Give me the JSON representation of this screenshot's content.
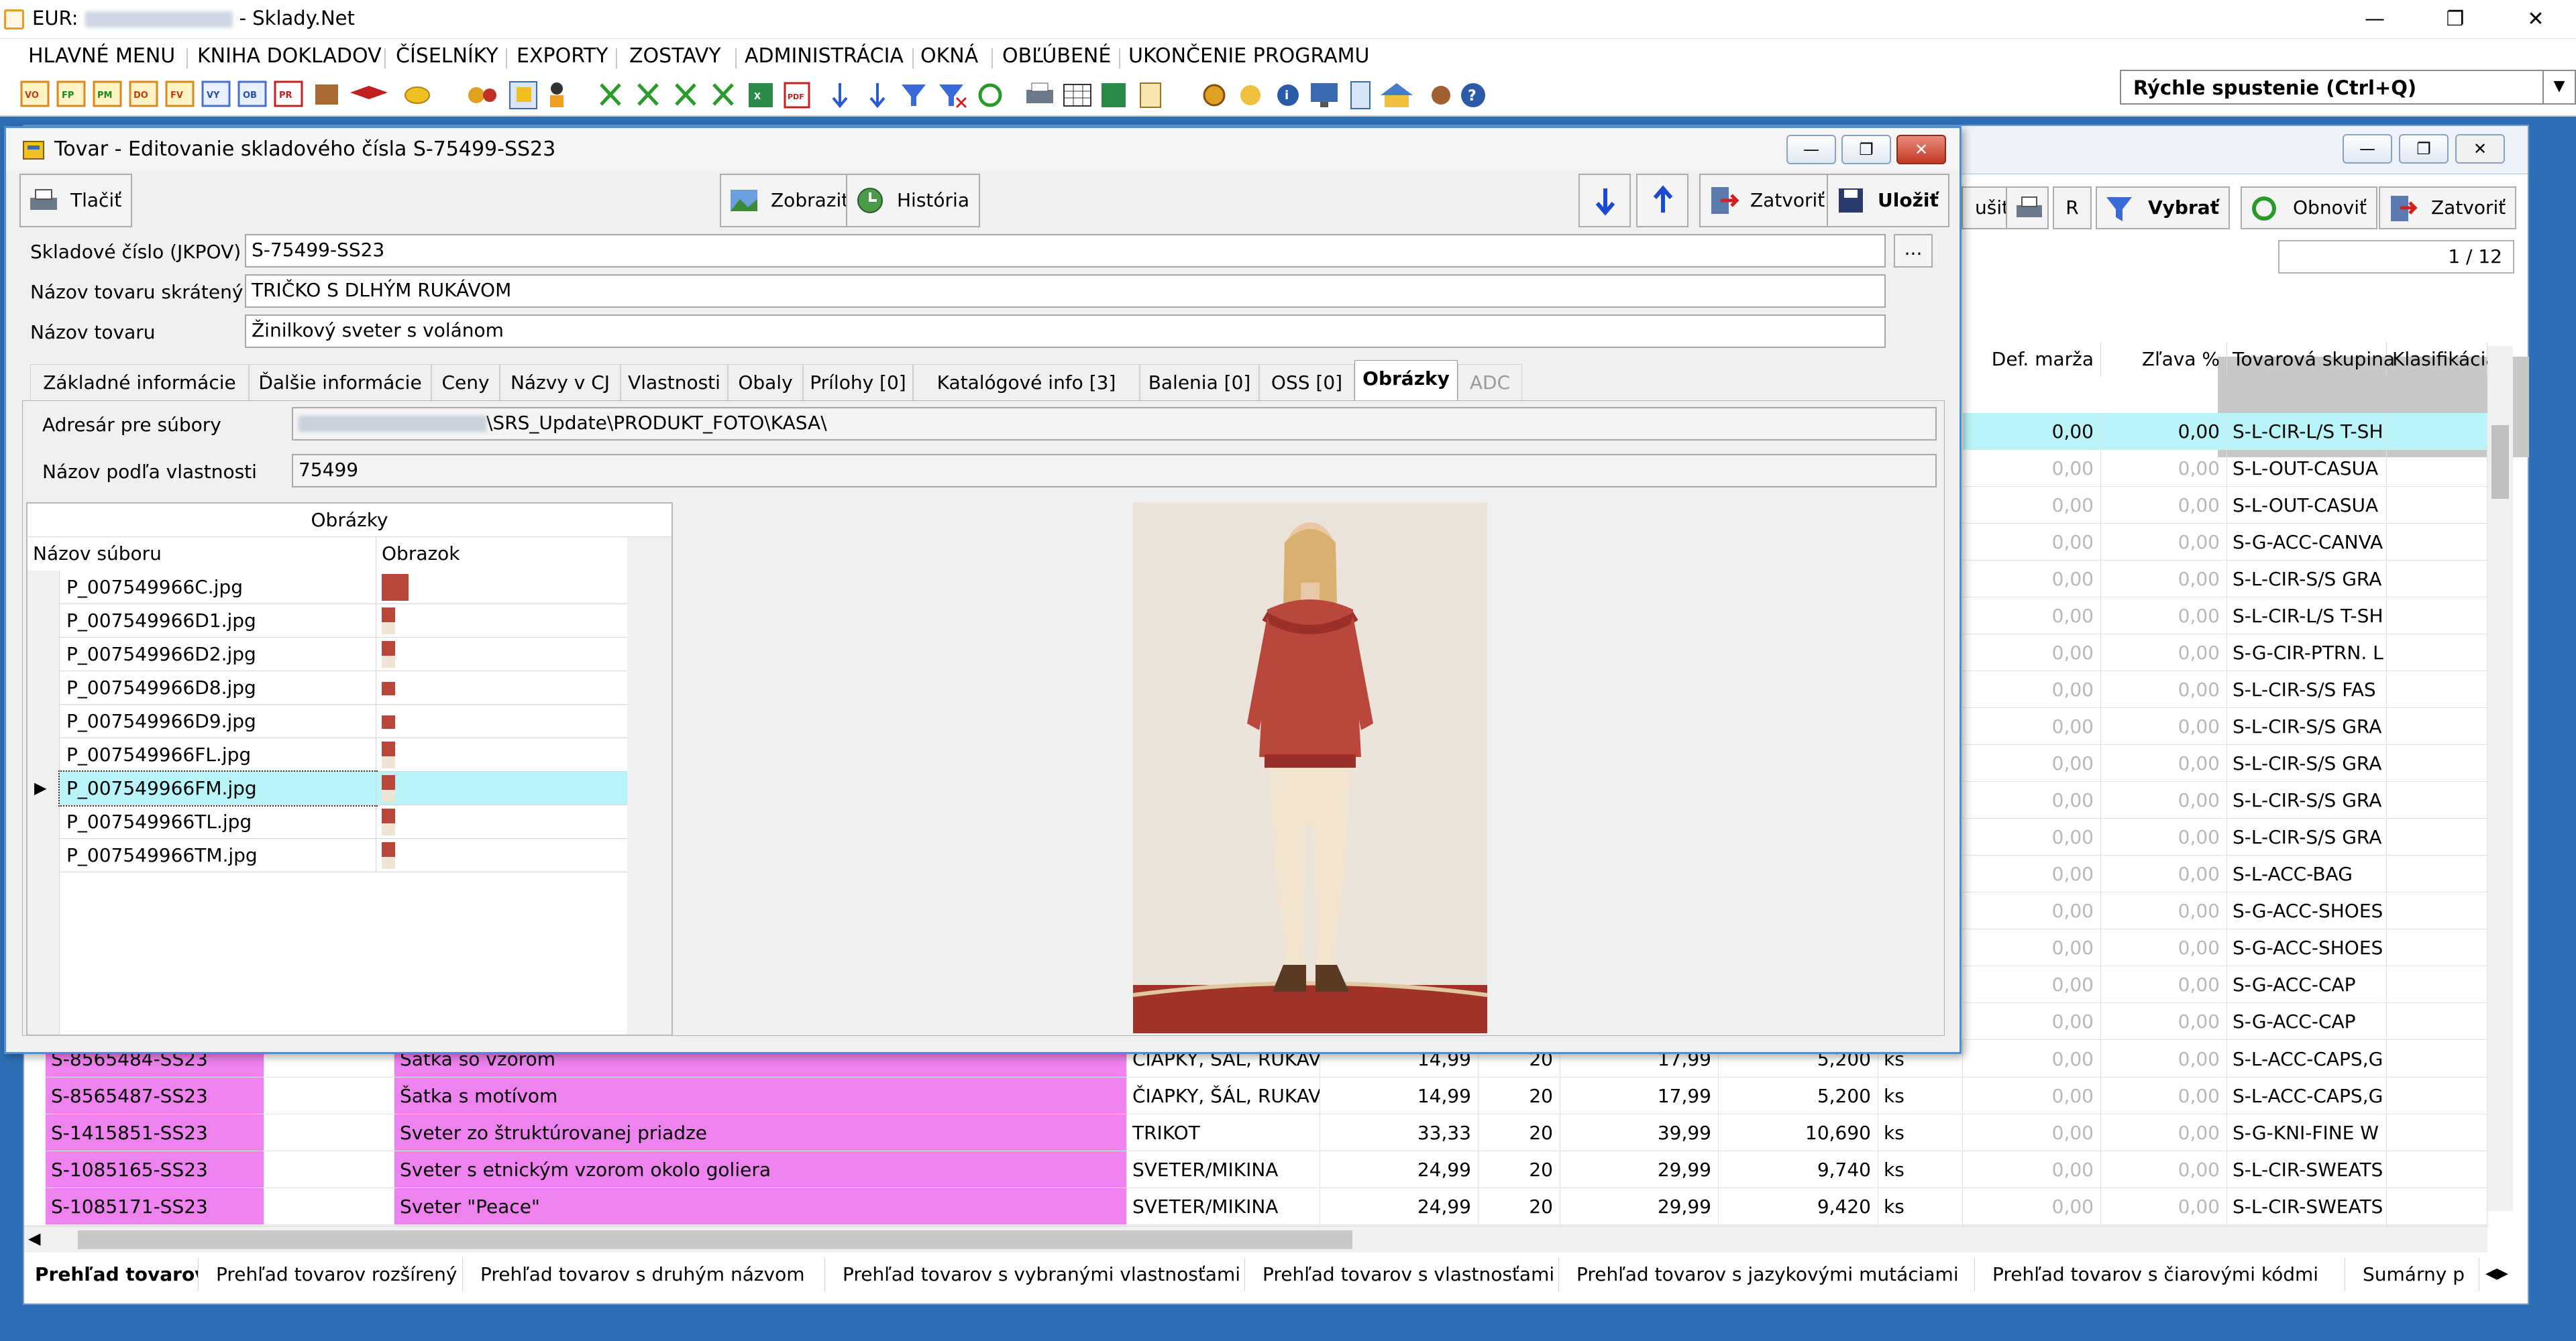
{
  "window": {
    "title_prefix": "EUR:",
    "title_suffix": "- Sklady.Net"
  },
  "menu": [
    "HLAVNÉ MENU",
    "KNIHA DOKLADOV",
    "ČÍSELNÍKY",
    "EXPORTY",
    "ZOSTAVY",
    "ADMINISTRÁCIA",
    "OKNÁ",
    "OBĽÚBENÉ",
    "UKONČENIE PROGRAMU"
  ],
  "quick_launch": {
    "label": "Rýchle spustenie (Ctrl+Q)"
  },
  "background_window": {
    "buttons": {
      "cancel_partial": "ušiť",
      "r": "R",
      "select": "Vybrať",
      "refresh": "Obnoviť",
      "close": "Zatvoriť"
    },
    "pager": "1 / 12",
    "headers": {
      "def_marza": "Def. marža",
      "zlava": "Zľava %",
      "skupina": "Tovarová skupina",
      "klasifikacia": "Klasifikácia"
    },
    "right_rows": [
      {
        "marza": "0,00",
        "zlava": "0,00",
        "skupina": "S-L-CIR-L/S T-SH"
      },
      {
        "marza": "0,00",
        "zlava": "0,00",
        "skupina": "S-L-OUT-CASUA"
      },
      {
        "marza": "0,00",
        "zlava": "0,00",
        "skupina": "S-L-OUT-CASUA"
      },
      {
        "marza": "0,00",
        "zlava": "0,00",
        "skupina": "S-G-ACC-CANVA"
      },
      {
        "marza": "0,00",
        "zlava": "0,00",
        "skupina": "S-L-CIR-S/S GRA"
      },
      {
        "marza": "0,00",
        "zlava": "0,00",
        "skupina": "S-L-CIR-L/S T-SH"
      },
      {
        "marza": "0,00",
        "zlava": "0,00",
        "skupina": "S-G-CIR-PTRN. L"
      },
      {
        "marza": "0,00",
        "zlava": "0,00",
        "skupina": "S-L-CIR-S/S FAS"
      },
      {
        "marza": "0,00",
        "zlava": "0,00",
        "skupina": "S-L-CIR-S/S GRA"
      },
      {
        "marza": "0,00",
        "zlava": "0,00",
        "skupina": "S-L-CIR-S/S GRA"
      },
      {
        "marza": "0,00",
        "zlava": "0,00",
        "skupina": "S-L-CIR-S/S GRA"
      },
      {
        "marza": "0,00",
        "zlava": "0,00",
        "skupina": "S-L-CIR-S/S GRA"
      },
      {
        "marza": "0,00",
        "zlava": "0,00",
        "skupina": "S-L-ACC-BAG"
      },
      {
        "marza": "0,00",
        "zlava": "0,00",
        "skupina": "S-G-ACC-SHOES"
      },
      {
        "marza": "0,00",
        "zlava": "0,00",
        "skupina": "S-G-ACC-SHOES"
      },
      {
        "marza": "0,00",
        "zlava": "0,00",
        "skupina": "S-G-ACC-CAP"
      },
      {
        "marza": "0,00",
        "zlava": "0,00",
        "skupina": "S-G-ACC-CAP"
      }
    ],
    "bottom_rows": [
      {
        "kod": "S-8565484-SS23",
        "nazov": "Šatka so vzorom",
        "skupina_nazov": "ČIAPKY, ŠÁL, RUKAVI",
        "c1": "14,99",
        "dph": "20",
        "c2": "17,99",
        "mn": "5,200",
        "mj": "ks",
        "marza": "0,00",
        "zlava": "0,00",
        "skupina": "S-L-ACC-CAPS,G"
      },
      {
        "kod": "S-8565487-SS23",
        "nazov": "Šatka s motívom",
        "skupina_nazov": "ČIAPKY, ŠÁL, RUKAVI",
        "c1": "14,99",
        "dph": "20",
        "c2": "17,99",
        "mn": "5,200",
        "mj": "ks",
        "marza": "0,00",
        "zlava": "0,00",
        "skupina": "S-L-ACC-CAPS,G"
      },
      {
        "kod": "S-1415851-SS23",
        "nazov": "Sveter zo štruktúrovanej priadze",
        "skupina_nazov": "TRIKOT",
        "c1": "33,33",
        "dph": "20",
        "c2": "39,99",
        "mn": "10,690",
        "mj": "ks",
        "marza": "0,00",
        "zlava": "0,00",
        "skupina": "S-G-KNI-FINE W"
      },
      {
        "kod": "S-1085165-SS23",
        "nazov": "Sveter s etnickým vzorom okolo goliera",
        "skupina_nazov": "SVETER/MIKINA",
        "c1": "24,99",
        "dph": "20",
        "c2": "29,99",
        "mn": "9,740",
        "mj": "ks",
        "marza": "0,00",
        "zlava": "0,00",
        "skupina": "S-L-CIR-SWEATS"
      },
      {
        "kod": "S-1085171-SS23",
        "nazov": "Sveter \"Peace\"",
        "skupina_nazov": "SVETER/MIKINA",
        "c1": "24,99",
        "dph": "20",
        "c2": "29,99",
        "mn": "9,420",
        "mj": "ks",
        "marza": "0,00",
        "zlava": "0,00",
        "skupina": "S-L-CIR-SWEATS"
      }
    ],
    "bottom_tabs": [
      "Prehľad tovarov",
      "Prehľad tovarov rozšírený",
      "Prehľad tovarov s druhým názvom",
      "Prehľad tovarov s vybranými vlastnosťami",
      "Prehľad tovarov s vlastnosťami",
      "Prehľad tovarov s jazykovými mutáciami",
      "Prehľad tovarov s čiarovými kódmi",
      "Sumárny p"
    ]
  },
  "dialog": {
    "title": "Tovar - Editovanie skladového čísla S-75499-SS23",
    "buttons": {
      "print": "Tlačiť",
      "show": "Zobraziť",
      "history": "História",
      "close": "Zatvoriť",
      "save": "Uložiť"
    },
    "fields": {
      "sku_label": "Skladové číslo (JKPOV)",
      "sku_value": "S-75499-SS23",
      "short_label": "Názov tovaru skrátený",
      "short_value": "TRIČKO S DLHÝM RUKÁVOM",
      "name_label": "Názov tovaru",
      "name_value": "Žinilkový sveter s volánom",
      "dots": "..."
    },
    "tabs": [
      "Základné informácie",
      "Ďalšie informácie",
      "Ceny",
      "Názvy v CJ",
      "Vlastnosti",
      "Obaly",
      "Prílohy [0]",
      "Katalógové info [3]",
      "Balenia [0]",
      "OSS [0]",
      "Obrázky",
      "ADC"
    ],
    "images_tab": {
      "dir_label": "Adresár pre súbory",
      "dir_value": "\\SRS_Update\\PRODUKT_FOTO\\KASA\\",
      "prop_label": "Názov podľa vlastnosti",
      "prop_value": "75499",
      "grid_title": "Obrázky",
      "col_file": "Názov súboru",
      "col_image": "Obrazok",
      "files": [
        "P_007549966C.jpg",
        "P_007549966D1.jpg",
        "P_007549966D2.jpg",
        "P_007549966D8.jpg",
        "P_007549966D9.jpg",
        "P_007549966FL.jpg",
        "P_007549966FM.jpg",
        "P_007549966TL.jpg",
        "P_007549966TM.jpg"
      ],
      "selected_index": 6
    }
  },
  "colors": {
    "accent": "#4a90d9",
    "pink_row": "#ee82ee",
    "cyan_row": "#b8f4f8",
    "sweater": "#b9473c"
  }
}
